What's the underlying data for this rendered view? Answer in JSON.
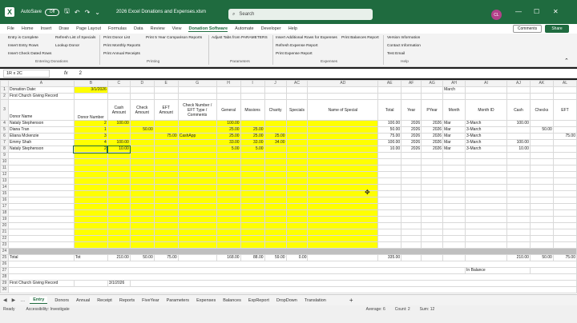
{
  "titlebar": {
    "app_letter": "X",
    "autosave": "AutoSave",
    "autosave_state": "Off",
    "doc_title": "2026 Excel Donations and Expenses.xlsm",
    "search_placeholder": "Search",
    "avatar": "CL"
  },
  "menu": [
    "File",
    "Home",
    "Insert",
    "Draw",
    "Page Layout",
    "Formulas",
    "Data",
    "Review",
    "View",
    "Donation Software",
    "Automate",
    "Developer",
    "Help"
  ],
  "menu_active": "Donation Software",
  "comments_label": "Comments",
  "share_label": "Share",
  "ribbon": {
    "entering": [
      "Entry is Complete",
      "Insert Entry Rows",
      "Insert Check Dated Rows"
    ],
    "entering2": [
      "Refresh List of Specials",
      "Lookup Donor"
    ],
    "printing1": [
      "Print Donor List",
      "Print Monthly Reports",
      "Print Annual Receipts"
    ],
    "printing2": [
      "Print 5 Year Comparison Reports"
    ],
    "params": [
      "Adjust Tabs from PARAMETERS"
    ],
    "expenses1": [
      "Insert Additional Rows for Expenses",
      "Refresh Expense Report",
      "Print Expense Report"
    ],
    "expenses2": [
      "Print Balances Report"
    ],
    "help": [
      "Version Information",
      "Contact Information",
      "Test Email"
    ],
    "groups": [
      "Entering Donations",
      "Printing",
      "Parameters",
      "Expenses",
      "Help"
    ]
  },
  "formula": {
    "namebox": "1R x 2C",
    "fx": "fx",
    "value": "2"
  },
  "columns": [
    "A",
    "B",
    "C",
    "D",
    "E",
    "G",
    "H",
    "I",
    "J",
    "AC",
    "AD",
    "AE",
    "AF",
    "AG",
    "AH",
    "AI",
    "AJ",
    "AK",
    "AL"
  ],
  "rows": {
    "r1": {
      "a": "Donation Date:",
      "b": "3/1/2026",
      "ah": "March"
    },
    "r2": {
      "a": "First Church Giving Record"
    },
    "r3": {
      "a": "Donor Name",
      "b": "Donor Number",
      "c": "Cash Amount",
      "d": "Check Amount",
      "e": "EFT Amount",
      "g": "Check Number / EFT Type / Comments",
      "h": "General",
      "i": "Missions",
      "j": "Charity",
      "ac": "Specials",
      "ad": "Name of Special",
      "ae": "Total",
      "af": "Year",
      "ag": "PYear",
      "ah": "Month",
      "ai": "Month ID",
      "aj": "Cash",
      "ak": "Checks",
      "al": "EFT"
    },
    "data": [
      {
        "name": "Nataly Stephenson",
        "num": "2",
        "cash": "100.00",
        "check": "",
        "eft": "",
        "cmt": "",
        "gen": "100.00",
        "mis": "",
        "cha": "",
        "total": "100.00",
        "year": "2026",
        "pyear": "2026",
        "month": "Mar",
        "mid": "3-March",
        "cashc": "100.00",
        "checkc": "",
        "eftc": ""
      },
      {
        "name": "Diana Tran",
        "num": "1",
        "cash": "",
        "check": "50.00",
        "eft": "",
        "cmt": "",
        "gen": "25.00",
        "mis": "25.00",
        "cha": "",
        "total": "50.00",
        "year": "2026",
        "pyear": "2026",
        "month": "Mar",
        "mid": "3-March",
        "cashc": "",
        "checkc": "50.00",
        "eftc": ""
      },
      {
        "name": "Eliana Mckenzie",
        "num": "3",
        "cash": "",
        "check": "",
        "eft": "75.00",
        "cmt": "CashApp",
        "gen": "25.00",
        "mis": "25.00",
        "cha": "25.00",
        "total": "75.00",
        "year": "2026",
        "pyear": "2026",
        "month": "Mar",
        "mid": "3-March",
        "cashc": "",
        "checkc": "",
        "eftc": "75.00"
      },
      {
        "name": "Emmy Shah",
        "num": "4",
        "cash": "100.00",
        "check": "",
        "eft": "",
        "cmt": "",
        "gen": "33.00",
        "mis": "33.00",
        "cha": "34.00",
        "total": "100.00",
        "year": "2026",
        "pyear": "2026",
        "month": "Mar",
        "mid": "3-March",
        "cashc": "100.00",
        "checkc": "",
        "eftc": ""
      },
      {
        "name": "Nataly Stephenson",
        "num": "2",
        "cash": "10.00",
        "check": "",
        "eft": "",
        "cmt": "",
        "gen": "5.00",
        "mis": "5.00",
        "cha": "",
        "total": "10.00",
        "year": "2026",
        "pyear": "2026",
        "month": "Mar",
        "mid": "3-March",
        "cashc": "10.00",
        "checkc": "",
        "eftc": ""
      }
    ],
    "r25": {
      "a": "Total",
      "b": "Tot",
      "c": "210.00",
      "d": "50.00",
      "e": "75.00",
      "h": "168.00",
      "i": "88.00",
      "j": "59.00",
      "ac": "0.00",
      "ae": "335.00",
      "aj": "210.00",
      "ak": "50.00",
      "al": "75.00"
    },
    "r27": {
      "aj": "In Balance"
    },
    "r29": {
      "a": "First Church Giving Record",
      "c": "3/1/2026"
    }
  },
  "sheets": [
    "Entry",
    "Donors",
    "Annual",
    "Receipt",
    "Reports",
    "FiveYear",
    "Parameters",
    "Expenses",
    "Balances",
    "ExpReport",
    "DropDown",
    "Translation"
  ],
  "status": {
    "ready": "Ready",
    "accessibility": "Accessibility: Investigate",
    "average": "Average: 6",
    "count": "Count: 2",
    "sum": "Sum: 12"
  }
}
